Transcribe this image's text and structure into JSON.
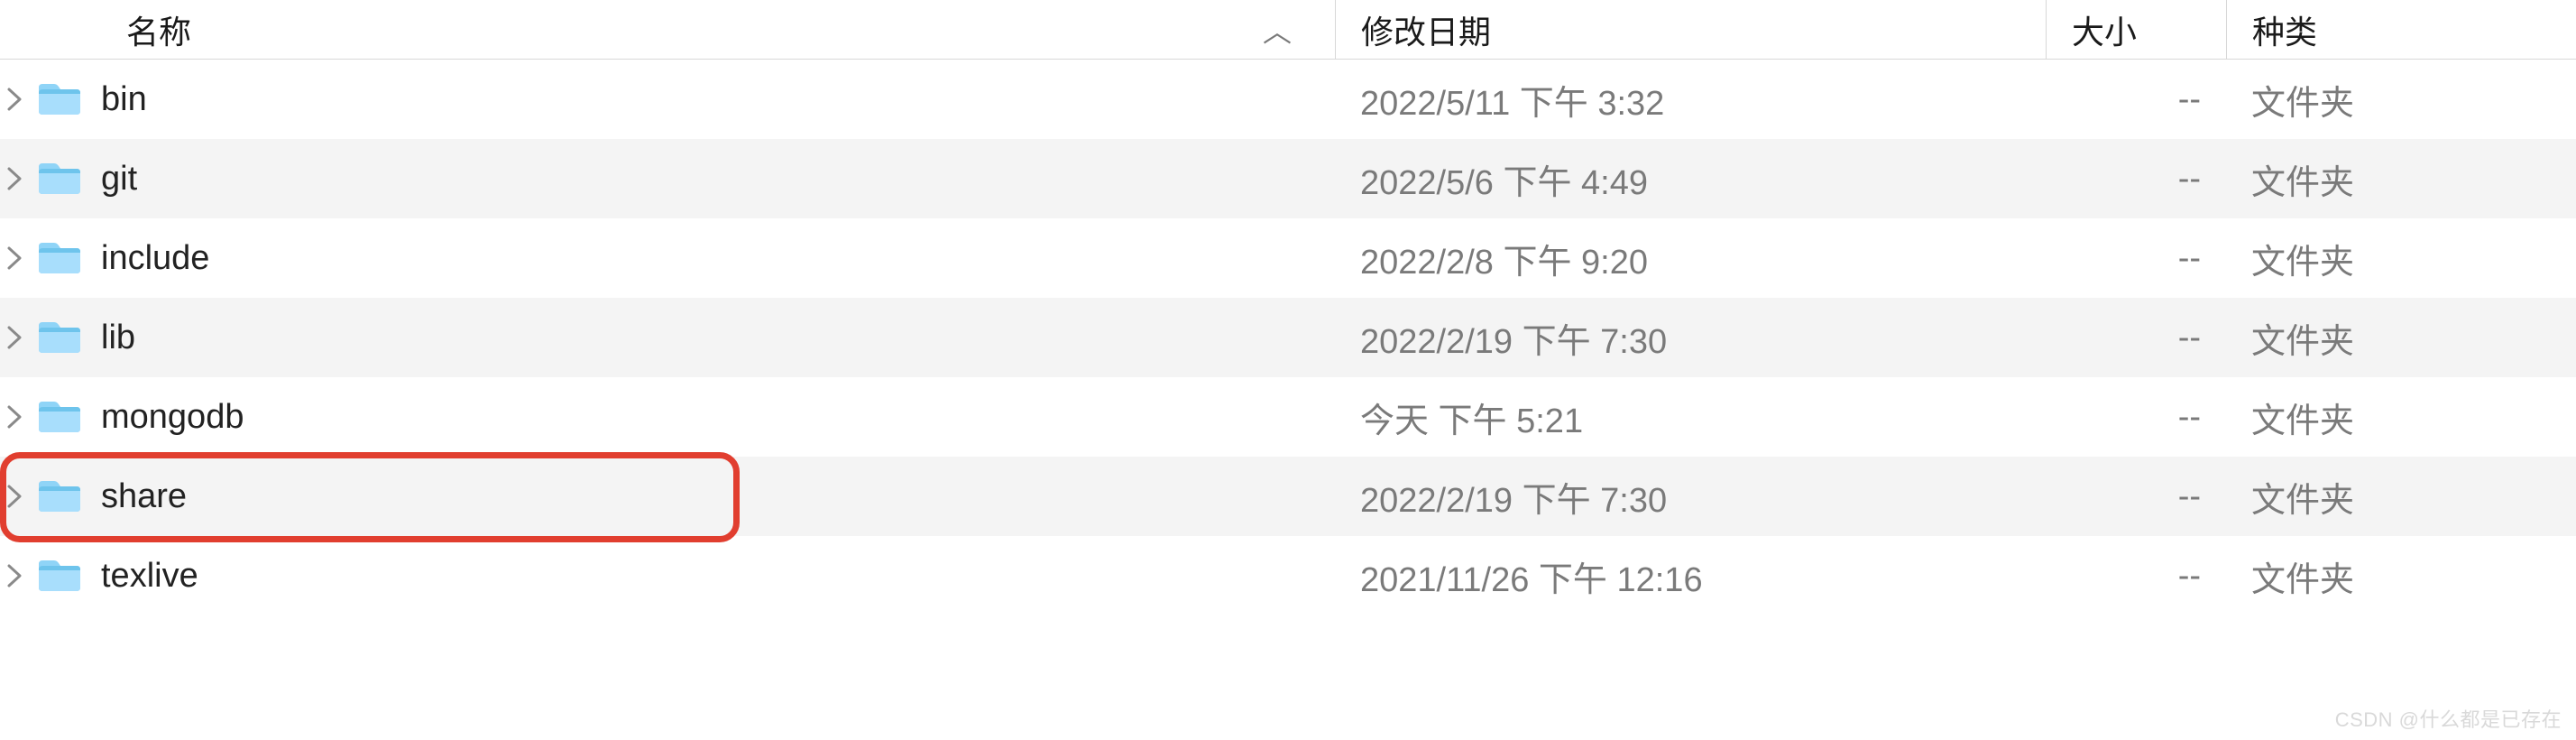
{
  "header": {
    "name_label": "名称",
    "date_label": "修改日期",
    "size_label": "大小",
    "kind_label": "种类",
    "sort_indicator": "︿"
  },
  "rows": [
    {
      "name": "bin",
      "date": "2022/5/11 下午 3:32",
      "size": "--",
      "kind": "文件夹",
      "alt": false
    },
    {
      "name": "git",
      "date": "2022/5/6 下午 4:49",
      "size": "--",
      "kind": "文件夹",
      "alt": true
    },
    {
      "name": "include",
      "date": "2022/2/8 下午 9:20",
      "size": "--",
      "kind": "文件夹",
      "alt": false
    },
    {
      "name": "lib",
      "date": "2022/2/19 下午 7:30",
      "size": "--",
      "kind": "文件夹",
      "alt": true
    },
    {
      "name": "mongodb",
      "date": "今天 下午 5:21",
      "size": "--",
      "kind": "文件夹",
      "alt": false
    },
    {
      "name": "share",
      "date": "2022/2/19 下午 7:30",
      "size": "--",
      "kind": "文件夹",
      "alt": true
    },
    {
      "name": "texlive",
      "date": "2021/11/26 下午 12:16",
      "size": "--",
      "kind": "文件夹",
      "alt": false
    }
  ],
  "watermark": "CSDN @什么都是已存在"
}
